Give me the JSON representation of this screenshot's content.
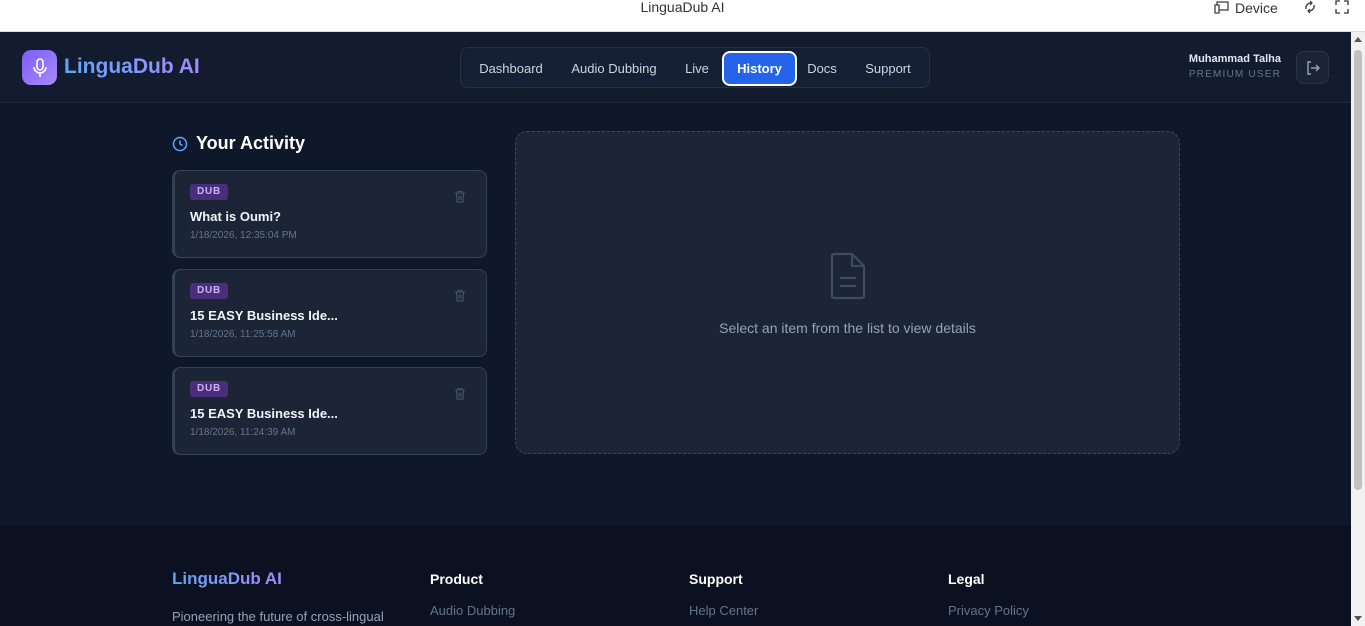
{
  "browser": {
    "title": "LinguaDub AI",
    "device_label": "Device"
  },
  "header": {
    "brand": "LinguaDub AI",
    "nav": [
      {
        "label": "Dashboard"
      },
      {
        "label": "Audio Dubbing"
      },
      {
        "label": "Live"
      },
      {
        "label": "History",
        "active": true
      },
      {
        "label": "Docs"
      },
      {
        "label": "Support"
      }
    ],
    "user": {
      "name": "Muhammad Talha",
      "role": "PREMIUM USER"
    }
  },
  "activity": {
    "title": "Your Activity",
    "items": [
      {
        "badge": "DUB",
        "title": "What is Oumi?",
        "date": "1/18/2026, 12:35:04 PM"
      },
      {
        "badge": "DUB",
        "title": "15 EASY Business Ide...",
        "date": "1/18/2026, 11:25:58 AM"
      },
      {
        "badge": "DUB",
        "title": "15 EASY Business Ide...",
        "date": "1/18/2026, 11:24:39 AM"
      }
    ]
  },
  "details": {
    "empty_text": "Select an item from the list to view details"
  },
  "footer": {
    "brand": "LinguaDub AI",
    "tagline": "Pioneering the future of cross-lingual",
    "columns": [
      {
        "heading": "Product",
        "link": "Audio Dubbing"
      },
      {
        "heading": "Support",
        "link": "Help Center"
      },
      {
        "heading": "Legal",
        "link": "Privacy Policy"
      }
    ]
  },
  "colors": {
    "background": "#0f172a",
    "accent": "#2563eb",
    "badge": "#4c2d7a"
  }
}
